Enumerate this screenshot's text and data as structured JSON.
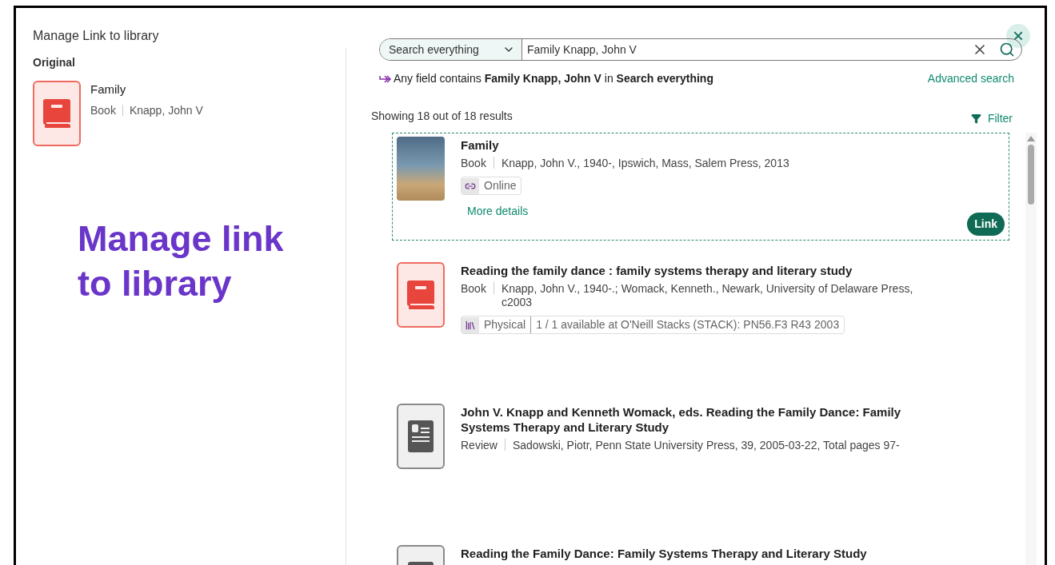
{
  "dialog": {
    "title": "Manage Link to library",
    "close": "×"
  },
  "original": {
    "heading": "Original",
    "title": "Family",
    "type": "Book",
    "author": "Knapp, John V",
    "kind": "book"
  },
  "caption": "Manage link to library",
  "search": {
    "scope": "Search everything",
    "value": "Family Knapp, John V"
  },
  "query_summary": "Any field contains **Family Knapp, John V** in **Search everything**",
  "advanced_search": "Advanced search",
  "results_count": "Showing 18 out of 18 results",
  "filter": "Filter",
  "results": [
    {
      "kind": "photo",
      "title": "Family",
      "type": "Book",
      "details": "Knapp, John V., 1940-, Ipswich, Mass, Salem Press, 2013",
      "availability": {
        "kind": "online",
        "label": "Online"
      },
      "more": "More details",
      "action": "Link",
      "selected": true
    },
    {
      "kind": "book",
      "title": "Reading the family dance : family systems therapy and literary study",
      "type": "Book",
      "details": "Knapp, John V., 1940-.; Womack, Kenneth., Newark, University of Delaware Press, c2003",
      "availability": {
        "kind": "physical",
        "label": "Physical",
        "note": "1 / 1 available at O'Neill Stacks (STACK): PN56.F3 R43 2003"
      },
      "selected": false
    },
    {
      "kind": "article",
      "title": "John V. Knapp and Kenneth Womack, eds. Reading the Family Dance: Family Systems Therapy and Literary Study",
      "type": "Review",
      "details": "Sadowski, Piotr, Penn State University Press, 39, 2005-03-22, Total pages 97-",
      "selected": false
    },
    {
      "kind": "article",
      "title": "Reading the Family Dance: Family Systems Therapy and Literary Study",
      "selected": false
    }
  ]
}
